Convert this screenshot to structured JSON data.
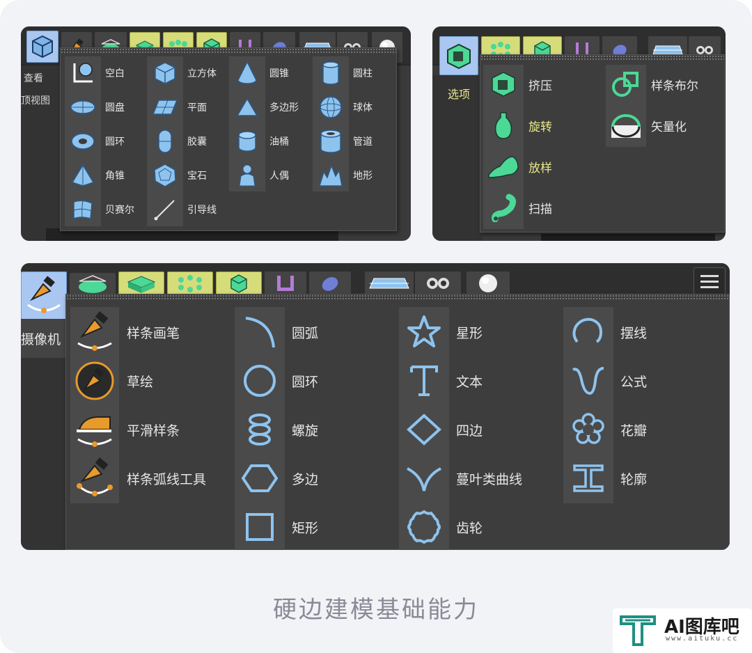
{
  "colors": {
    "accent_blue": "#8ec3ee",
    "accent_green": "#4cd896",
    "accent_orange": "#e89a2c",
    "highlight_text": "#e8e88a"
  },
  "panel1": {
    "side_labels": [
      "查看",
      "顶视图"
    ],
    "columns": [
      [
        {
          "label": "空白",
          "icon": "null-axis-icon"
        },
        {
          "label": "圆盘",
          "icon": "disc-icon"
        },
        {
          "label": "圆环",
          "icon": "torus-icon"
        },
        {
          "label": "角锥",
          "icon": "pyramid-icon"
        },
        {
          "label": "贝赛尔",
          "icon": "bezier-surface-icon"
        }
      ],
      [
        {
          "label": "立方体",
          "icon": "cube-icon"
        },
        {
          "label": "平面",
          "icon": "plane-icon"
        },
        {
          "label": "胶囊",
          "icon": "capsule-icon"
        },
        {
          "label": "宝石",
          "icon": "gem-icon"
        },
        {
          "label": "引导线",
          "icon": "guide-line-icon"
        }
      ],
      [
        {
          "label": "圆锥",
          "icon": "cone-icon"
        },
        {
          "label": "多边形",
          "icon": "polygon-icon"
        },
        {
          "label": "油桶",
          "icon": "oil-tank-icon"
        },
        {
          "label": "人偶",
          "icon": "figure-icon"
        }
      ],
      [
        {
          "label": "圆柱",
          "icon": "cylinder-icon"
        },
        {
          "label": "球体",
          "icon": "sphere-icon"
        },
        {
          "label": "管道",
          "icon": "tube-icon"
        },
        {
          "label": "地形",
          "icon": "landscape-icon"
        }
      ]
    ]
  },
  "panel2": {
    "side_labels": [
      "选项"
    ],
    "columns": [
      [
        {
          "label": "挤压",
          "icon": "extrude-icon"
        },
        {
          "label": "旋转",
          "icon": "lathe-icon",
          "highlight": true
        },
        {
          "label": "放样",
          "icon": "loft-icon",
          "highlight": true
        },
        {
          "label": "扫描",
          "icon": "sweep-icon"
        }
      ],
      [
        {
          "label": "样条布尔",
          "icon": "spline-boolean-icon"
        },
        {
          "label": "矢量化",
          "icon": "vectorize-icon"
        }
      ]
    ]
  },
  "panel3": {
    "side_labels": [
      "摄像机"
    ],
    "columns": [
      [
        {
          "label": "样条画笔",
          "icon": "spline-pen-icon"
        },
        {
          "label": "草绘",
          "icon": "sketch-icon"
        },
        {
          "label": "平滑样条",
          "icon": "smooth-spline-icon"
        },
        {
          "label": "样条弧线工具",
          "icon": "spline-arc-tool-icon"
        }
      ],
      [
        {
          "label": "圆弧",
          "icon": "arc-icon"
        },
        {
          "label": "圆环",
          "icon": "circle-icon"
        },
        {
          "label": "螺旋",
          "icon": "helix-icon"
        },
        {
          "label": "多边",
          "icon": "hexagon-icon"
        },
        {
          "label": "矩形",
          "icon": "rectangle-icon"
        }
      ],
      [
        {
          "label": "星形",
          "icon": "star-icon"
        },
        {
          "label": "文本",
          "icon": "text-icon"
        },
        {
          "label": "四边",
          "icon": "quad-icon"
        },
        {
          "label": "蔓叶类曲线",
          "icon": "cissoid-icon"
        },
        {
          "label": "齿轮",
          "icon": "cogwheel-icon"
        }
      ],
      [
        {
          "label": "摆线",
          "icon": "cycloid-icon"
        },
        {
          "label": "公式",
          "icon": "formula-icon"
        },
        {
          "label": "花瓣",
          "icon": "flower-icon"
        },
        {
          "label": "轮廓",
          "icon": "profile-icon"
        }
      ]
    ]
  },
  "caption": "硬边建模基础能力",
  "watermark": {
    "brand": "AI图库吧",
    "url": "www.aituku.cc"
  }
}
